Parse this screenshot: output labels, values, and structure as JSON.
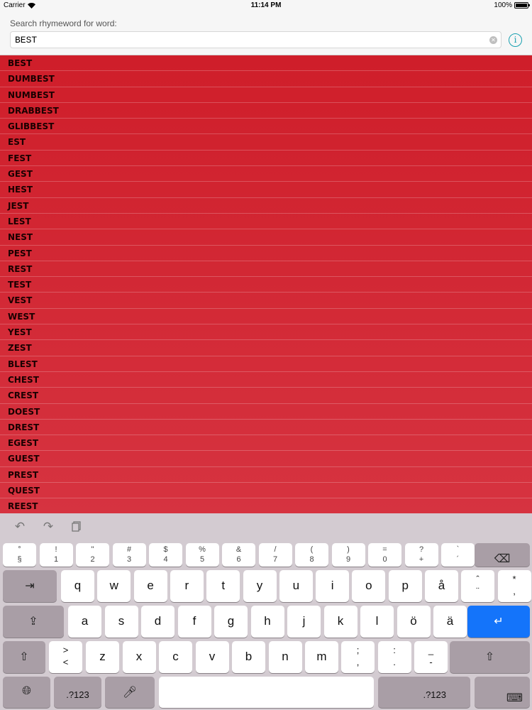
{
  "status_bar": {
    "carrier": "Carrier",
    "time": "11:14 PM",
    "battery": "100%",
    "battery_level": 1.0
  },
  "search": {
    "label": "Search rhymeword for word:",
    "value": "BEST"
  },
  "results": [
    "BEST",
    "DUMBEST",
    "NUMBEST",
    "DRABBEST",
    "GLIBBEST",
    "EST",
    "FEST",
    "GEST",
    "HEST",
    "JEST",
    "LEST",
    "NEST",
    "PEST",
    "REST",
    "TEST",
    "VEST",
    "WEST",
    "YEST",
    "ZEST",
    "BLEST",
    "CHEST",
    "CREST",
    "DOEST",
    "DREST",
    "EGEST",
    "GUEST",
    "PREST",
    "QUEST",
    "REEST"
  ],
  "keyboard": {
    "assist_icons": [
      "undo-icon",
      "redo-icon",
      "paste-icon"
    ],
    "number_row": [
      {
        "top": "°",
        "bottom": "§"
      },
      {
        "top": "!",
        "bottom": "1"
      },
      {
        "top": "\"",
        "bottom": "2"
      },
      {
        "top": "#",
        "bottom": "3"
      },
      {
        "top": "$",
        "bottom": "4"
      },
      {
        "top": "%",
        "bottom": "5"
      },
      {
        "top": "&",
        "bottom": "6"
      },
      {
        "top": "/",
        "bottom": "7"
      },
      {
        "top": "(",
        "bottom": "8"
      },
      {
        "top": ")",
        "bottom": "9"
      },
      {
        "top": "=",
        "bottom": "0"
      },
      {
        "top": "?",
        "bottom": "+"
      },
      {
        "top": "`",
        "bottom": "´"
      }
    ],
    "row1": [
      "q",
      "w",
      "e",
      "r",
      "t",
      "y",
      "u",
      "i",
      "o",
      "p",
      "å"
    ],
    "row1_extra": [
      {
        "top": "ˆ",
        "bottom": "¨"
      },
      {
        "top": "*",
        "bottom": ","
      }
    ],
    "row2": [
      "a",
      "s",
      "d",
      "f",
      "g",
      "h",
      "j",
      "k",
      "l",
      "ö",
      "ä"
    ],
    "row3_first": {
      "top": ">",
      "bottom": "<"
    },
    "row3": [
      "z",
      "x",
      "c",
      "v",
      "b",
      "n",
      "m"
    ],
    "row3_extra": [
      {
        "top": ";",
        "bottom": ","
      },
      {
        "top": ":",
        "bottom": "."
      },
      {
        "top": "_",
        "bottom": "-"
      }
    ],
    "numbers_label": ".?123"
  }
}
